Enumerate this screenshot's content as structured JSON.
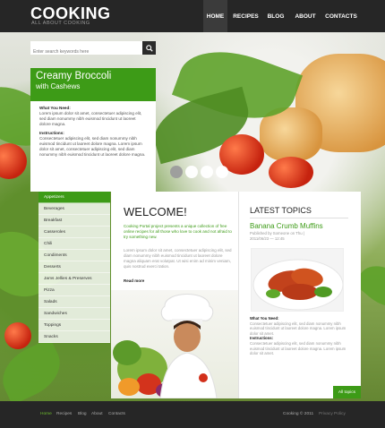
{
  "header": {
    "logo": "COOKING",
    "tagline": "ALL ABOUT COOKING",
    "nav": [
      {
        "label": "HOME",
        "active": true
      },
      {
        "label": "RECIPES",
        "active": false
      },
      {
        "label": "BLOG",
        "active": false
      },
      {
        "label": "ABOUT",
        "active": false
      },
      {
        "label": "CONTACTS",
        "active": false
      }
    ]
  },
  "search": {
    "placeholder": "Enter search keywords here",
    "icon": "search-icon"
  },
  "feature": {
    "title": "Creamy Broccoli",
    "subtitle": "with Cashews",
    "needs_label": "What You Need:",
    "needs_text": "Lorem ipsum dolor sit amet, consectetuer adipiscing elit, sed diam nonummy nibh euismod tincidunt ut laoreet dolore magna.",
    "instructions_label": "Instructions:",
    "instructions_text": "Consectetuer adipiscing elit, sed diam nonummy nibh euismod tincidunt ut laoreet dolore magna. Lorem ipsum dolor sit amet, consectetuer adipiscing elit, sed diam nonummy nibh euismod tincidunt ut laoreet dolore magna."
  },
  "slider": {
    "count": 4,
    "active_index": 0
  },
  "sidebar": {
    "items": [
      {
        "label": "Appetizers",
        "active": true
      },
      {
        "label": "Beverages",
        "active": false
      },
      {
        "label": "Breakfast",
        "active": false
      },
      {
        "label": "Casseroles",
        "active": false
      },
      {
        "label": "Chili",
        "active": false
      },
      {
        "label": "Condiments",
        "active": false
      },
      {
        "label": "Desserts",
        "active": false
      },
      {
        "label": "Jams Jellies & Preserves",
        "active": false
      },
      {
        "label": "Pizza",
        "active": false
      },
      {
        "label": "Salads",
        "active": false
      },
      {
        "label": "Sandwiches",
        "active": false
      },
      {
        "label": "Toppings",
        "active": false
      },
      {
        "label": "Snacks",
        "active": false
      }
    ]
  },
  "welcome": {
    "heading": "WELCOME!",
    "intro": "Cooking Portal project presents a unique collection of free online recipes for all those who love to cook and not afraid to try something new.",
    "text": "Lorem ipsum dolor sit amet, consectetuer adipiscing elit, sed diam nonummy nibh euismod tincidunt ut laoreet dolore magna aliquam erat volutpat. Ut wisi enim ad minim veniam, quis nostrud exerci tation.",
    "read_more": "Read more"
  },
  "latest": {
    "heading": "LATEST TOPICS",
    "post_title": "Banana Crumb Muffins",
    "post_author": "Published by Someone on Thu |",
    "post_date": "2011/06/23 — 12:45",
    "needs_label": "What You Need:",
    "needs_text": "Consectetuer adipiscing elit, sed diam nonummy nibh euismod tincidunt ut laoreet dolore magna. Lorem ipsum dolor sit amet.",
    "instructions_label": "Instructions:",
    "instructions_text": "Consectetuer adipiscing elit, sed diam nonummy nibh euismod tincidunt ut laoreet dolore magna. Lorem ipsum dolor sit amet.",
    "all_topics": "All topics"
  },
  "footer": {
    "nav": [
      {
        "label": "Home",
        "active": true
      },
      {
        "label": "Recipes",
        "active": false
      },
      {
        "label": "Blog",
        "active": false
      },
      {
        "label": "About",
        "active": false
      },
      {
        "label": "Contacts",
        "active": false
      }
    ],
    "copyright": "Cooking © 2011",
    "privacy": "Privacy Policy"
  },
  "colors": {
    "accent_green": "#3d9b17",
    "dark_bar": "#262626"
  }
}
